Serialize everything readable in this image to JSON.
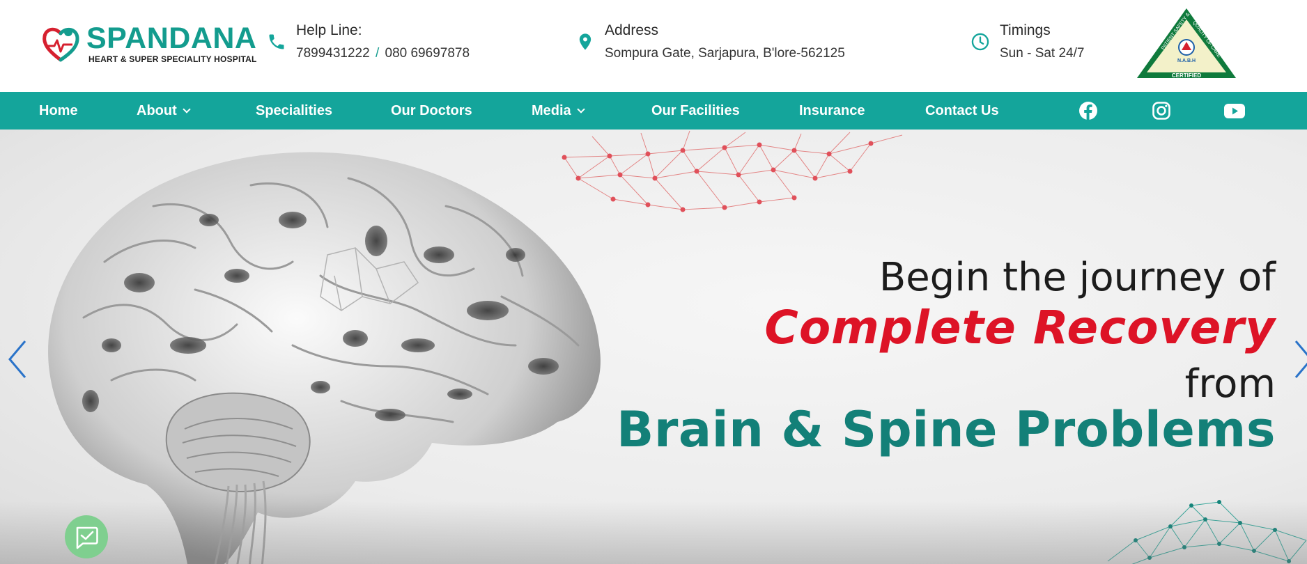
{
  "brand": {
    "name": "SPANDANA",
    "tagline": "HEART & SUPER SPECIALITY HOSPITAL",
    "primary_color": "#14a59b",
    "accent_color": "#dd1326"
  },
  "header": {
    "helpline": {
      "icon": "phone-icon",
      "label": "Help Line:",
      "number1": "7899431222",
      "separator": "/",
      "number2": "080 69697878"
    },
    "address": {
      "icon": "location-pin-icon",
      "label": "Address",
      "value": "Sompura Gate, Sarjapura, B'lore-562125"
    },
    "timings": {
      "icon": "clock-icon",
      "label": "Timings",
      "value": "Sun - Sat 24/7"
    },
    "certification": {
      "icon": "nabh-certified-badge",
      "arc_left": "PATIENT SAFETY &",
      "arc_right": "QUALITY OF CARE",
      "org": "N.A.B.H",
      "status": "CERTIFIED"
    }
  },
  "nav": {
    "items": [
      {
        "label": "Home",
        "has_dropdown": false
      },
      {
        "label": "About",
        "has_dropdown": true
      },
      {
        "label": "Specialities",
        "has_dropdown": false
      },
      {
        "label": "Our Doctors",
        "has_dropdown": false
      },
      {
        "label": "Media",
        "has_dropdown": true
      },
      {
        "label": "Our Facilities",
        "has_dropdown": false
      },
      {
        "label": "Insurance",
        "has_dropdown": false
      },
      {
        "label": "Contact Us",
        "has_dropdown": false
      }
    ],
    "social": [
      "facebook-icon",
      "instagram-icon",
      "youtube-icon"
    ]
  },
  "hero": {
    "line1": "Begin the journey of",
    "line2": "Complete Recovery",
    "line3": "from",
    "line4": "Brain & Spine Problems",
    "colors": {
      "line2": "#dd1326",
      "line4": "#138078"
    },
    "prev_icon": "chevron-left-icon",
    "next_icon": "chevron-right-icon"
  },
  "chat_widget": {
    "icon": "chat-check-icon"
  }
}
